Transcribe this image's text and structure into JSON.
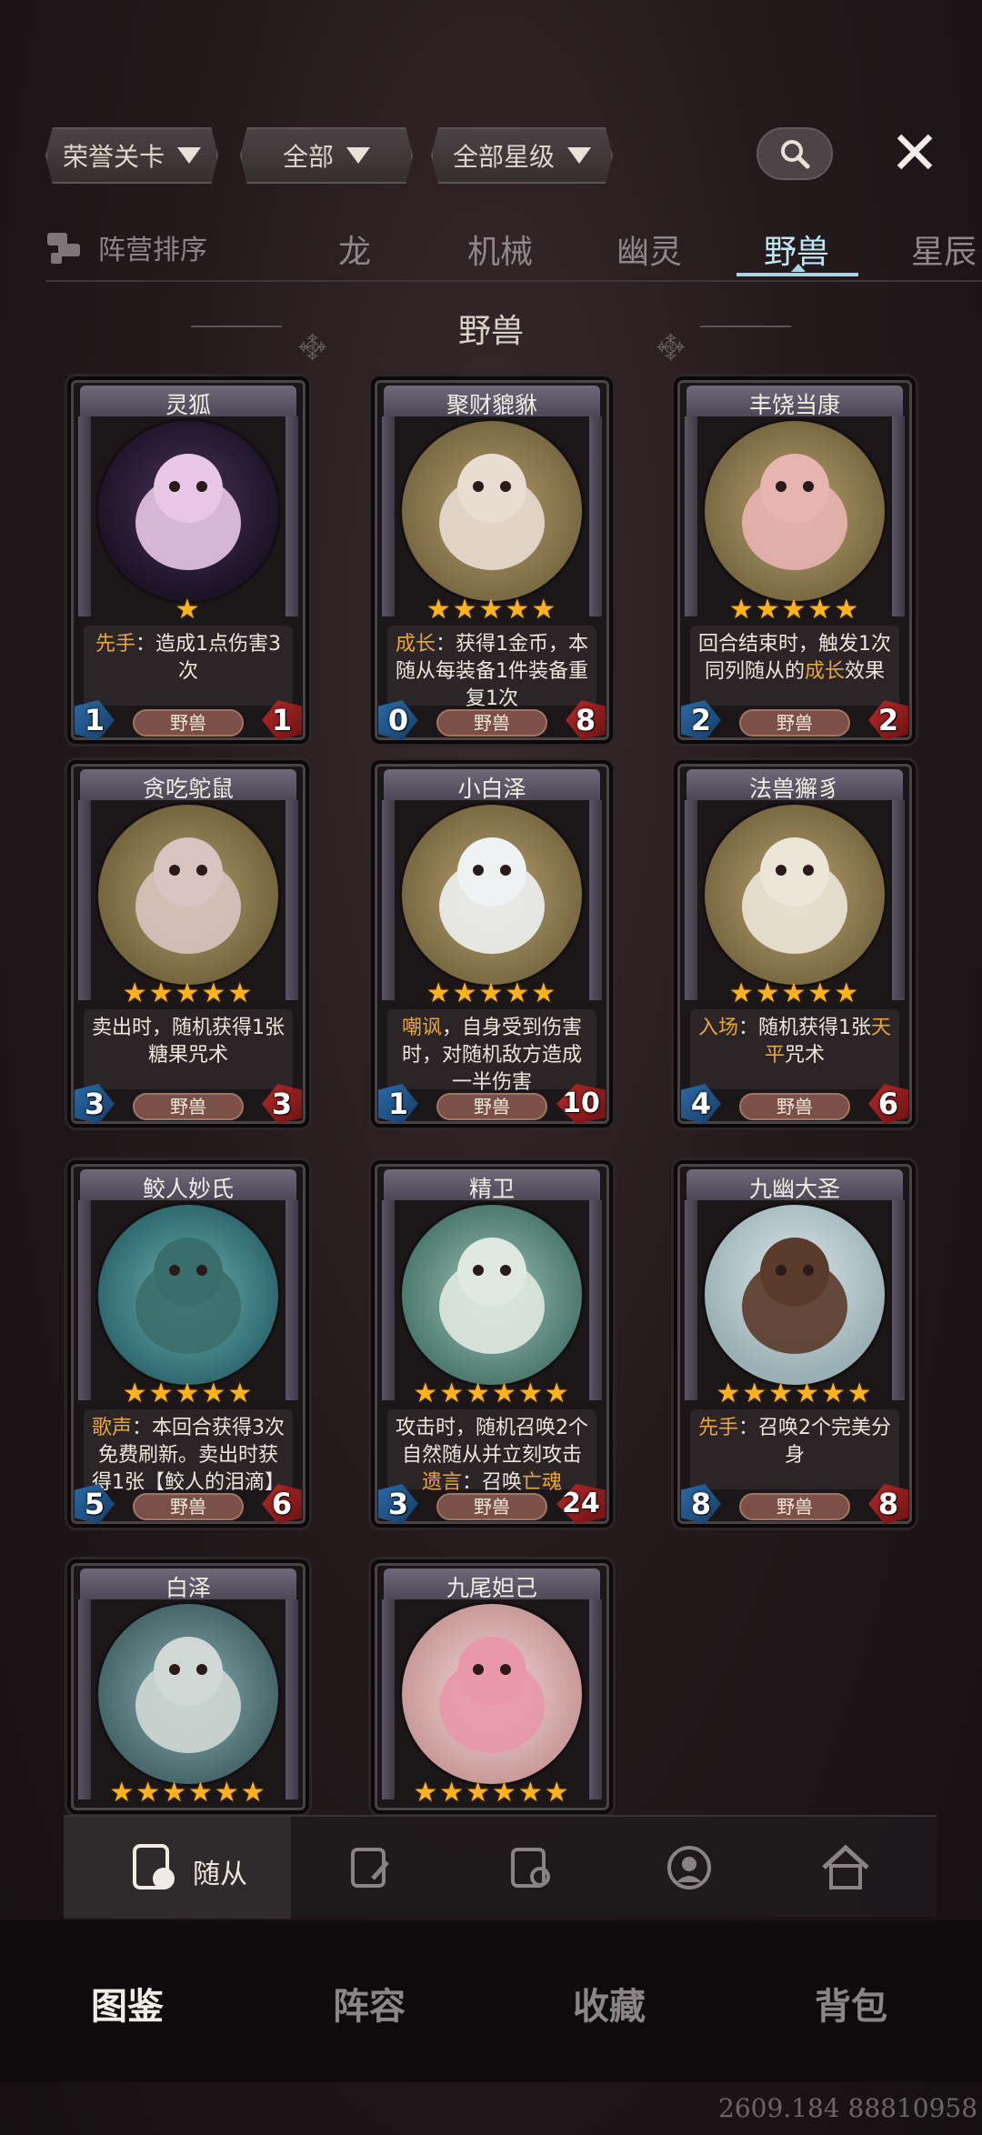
{
  "filters": {
    "level": "荣誉关卡",
    "faction": "全部",
    "stars": "全部星级"
  },
  "tabs": {
    "sort_label": "阵营排序",
    "items": [
      "龙",
      "机械",
      "幽灵",
      "野兽",
      "星辰"
    ],
    "active": "野兽"
  },
  "section_title": "野兽",
  "cards": [
    {
      "name": "灵狐",
      "stars": "★",
      "desc_parts": [
        {
          "kw": "先手"
        },
        {
          "t": "：造成1点伤害3次"
        }
      ],
      "tribe": "野兽",
      "atk": "1",
      "hp": "1"
    },
    {
      "name": "聚财貔貅",
      "stars": "★★★★★",
      "desc_parts": [
        {
          "kw": "成长"
        },
        {
          "t": "：获得1金币，本随从每装备1件装备重复1次"
        }
      ],
      "tribe": "野兽",
      "atk": "0",
      "hp": "8"
    },
    {
      "name": "丰饶当康",
      "stars": "★★★★★",
      "desc_parts": [
        {
          "t": "回合结束时，触发1次同列随从的"
        },
        {
          "kw": "成长"
        },
        {
          "t": "效果"
        }
      ],
      "tribe": "野兽",
      "atk": "2",
      "hp": "2"
    },
    {
      "name": "贪吃鸵鼠",
      "stars": "★★★★★",
      "desc_parts": [
        {
          "t": "卖出时，随机获得1张糖果咒术"
        }
      ],
      "tribe": "野兽",
      "atk": "3",
      "hp": "3"
    },
    {
      "name": "小白泽",
      "stars": "★★★★★",
      "desc_parts": [
        {
          "kw": "嘲讽"
        },
        {
          "t": "，自身受到伤害时，对随机敌方造成一半伤害"
        }
      ],
      "tribe": "野兽",
      "atk": "1",
      "hp": "10"
    },
    {
      "name": "法兽獬豸",
      "stars": "★★★★★",
      "desc_parts": [
        {
          "kw": "入场"
        },
        {
          "t": "：随机获得1张"
        },
        {
          "kw": "天平"
        },
        {
          "t": "咒术"
        }
      ],
      "tribe": "野兽",
      "atk": "4",
      "hp": "6"
    },
    {
      "name": "鲛人妙氏",
      "stars": "★★★★★",
      "desc_parts": [
        {
          "kw": "歌声"
        },
        {
          "t": "：本回合获得3次免费刷新。卖出时获得1张【鲛人的泪滴】"
        }
      ],
      "tribe": "野兽",
      "atk": "5",
      "hp": "6"
    },
    {
      "name": "精卫",
      "stars": "★★★★★★",
      "desc_parts": [
        {
          "t": "攻击时，随机召唤2个自然随从并立刻攻击"
        },
        {
          "kw": "遗言"
        },
        {
          "t": "：召唤"
        },
        {
          "kw": "亡魂"
        }
      ],
      "tribe": "野兽",
      "atk": "3",
      "hp": "24"
    },
    {
      "name": "九幽大圣",
      "stars": "★★★★★★",
      "desc_parts": [
        {
          "kw": "先手"
        },
        {
          "t": "：召唤2个完美分身"
        }
      ],
      "tribe": "野兽",
      "atk": "8",
      "hp": "8"
    },
    {
      "name": "白泽",
      "stars": "★★★★★★",
      "desc_parts": [],
      "tribe": "",
      "atk": "",
      "hp": ""
    },
    {
      "name": "九尾妲己",
      "stars": "★★★★★★",
      "desc_parts": [],
      "tribe": "",
      "atk": "",
      "hp": ""
    }
  ],
  "subnav": {
    "active_label": "随从",
    "icons": [
      "minion-card-icon",
      "spell-card-icon",
      "equipment-card-icon",
      "hero-portrait-icon",
      "home-icon"
    ]
  },
  "mainnav": {
    "items": [
      "图鉴",
      "阵容",
      "收藏",
      "背包"
    ],
    "active": "图鉴"
  },
  "footer_code": "2609.184 88810958",
  "colors": {
    "keyword": "#e8a63a",
    "tab_active": "#bfe6f4",
    "attack": "#2b6aa6",
    "health": "#b52a2a",
    "star": "#ffb21f"
  }
}
